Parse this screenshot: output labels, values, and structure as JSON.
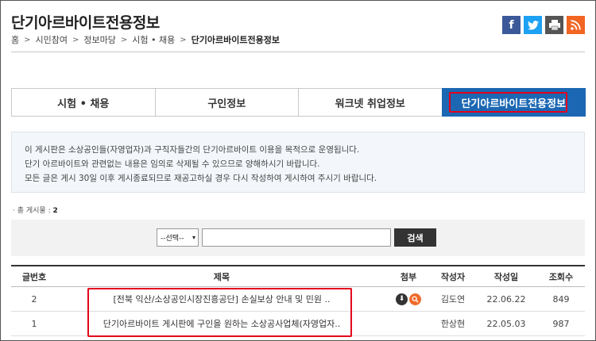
{
  "page": {
    "title": "단기아르바이트전용정보",
    "breadcrumb": [
      "홈",
      "시민참여",
      "정보마당",
      "시험 • 채용",
      "단기아르바이트전용정보"
    ],
    "breadcrumb_sep": ">"
  },
  "share_icons": [
    "facebook-icon",
    "twitter-icon",
    "print-icon",
    "rss-icon"
  ],
  "tabs": [
    {
      "label": "시험 • 채용",
      "active": false
    },
    {
      "label": "구인정보",
      "active": false
    },
    {
      "label": "워크넷 취업정보",
      "active": false
    },
    {
      "label": "단기아르바이트전용정보",
      "active": true
    }
  ],
  "notice": [
    "이 게시판은 소상공인들(자영업자)과 구직자들간의 단기아르바이트 이용을 목적으로 운영됩니다.",
    "단기 아르바이트와 관련없는 내용은 임의로 삭제될 수 있으므로 양해하시기 바랍니다.",
    "모든 글은 게시 30일 이후 게시종료되므로 재공고하실 경우 다시 작성하여 게시하여 주시기 바랍니다."
  ],
  "total": {
    "label": "총 게시물 :",
    "count": "2"
  },
  "search": {
    "select_value": "--선택--",
    "input_value": "",
    "button_label": "검색"
  },
  "table": {
    "headers": [
      "글번호",
      "제목",
      "첨부",
      "작성자",
      "작성일",
      "조회수"
    ],
    "rows": [
      {
        "no": "2",
        "title": "[전북 익산/소상공인시장진흥공단] 손실보상 안내 및 민원 ..",
        "attachments": [
          "download-icon",
          "preview-icon"
        ],
        "author": "김도연",
        "date": "22.06.22",
        "views": "849"
      },
      {
        "no": "1",
        "title": "단기아르바이트 게시판에 구인을 원하는 소상공사업체(자영업자..",
        "attachments": [],
        "author": "한상현",
        "date": "22.05.03",
        "views": "987"
      }
    ]
  },
  "colors": {
    "tab_active": "#1b67b3",
    "highlight": "#e3001b",
    "notice_bg": "#f3f7fb"
  }
}
